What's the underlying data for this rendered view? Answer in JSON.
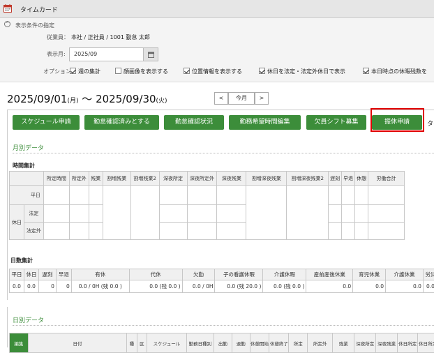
{
  "app": {
    "title": "タイムカード"
  },
  "conditions": {
    "toggle_label": "表示条件の指定",
    "employee_label": "従業員：",
    "employee_value": "本社 / 正社員 / 1001 勤怠 太郎",
    "month_label": "表示月:",
    "month_value": "2025/09",
    "options_label": "オプション:",
    "options": [
      {
        "label": "週の集計",
        "checked": true
      },
      {
        "label": "顔画像を表示する",
        "checked": false
      },
      {
        "label": "位置情報を表示する",
        "checked": true
      },
      {
        "label": "休日を法定・法定外休日で表示",
        "checked": true
      },
      {
        "label": "本日時点の休暇残数を",
        "checked": true
      }
    ]
  },
  "period": {
    "start": "2025/09/01",
    "start_dow": "(月)",
    "sep": "〜",
    "end": "2025/09/30",
    "end_dow": "(火)",
    "prev": "<",
    "today": "今月",
    "next": ">"
  },
  "actions": [
    {
      "label": "スケジュール申請"
    },
    {
      "label": "勤怠確認済みとする"
    },
    {
      "label": "勤怠確認状況"
    },
    {
      "label": "勤務希望時間編集"
    },
    {
      "label": "欠員シフト募集"
    },
    {
      "label": "振休申請"
    },
    {
      "label": "タイ"
    }
  ],
  "monthly": {
    "title": "月別データ",
    "time_title": "時間集計",
    "time_headers": [
      "所定時間",
      "所定外",
      "残業",
      "割増残業",
      "割増残業2",
      "深夜所定",
      "深夜所定外",
      "深夜残業",
      "割増深夜残業",
      "割増深夜残業2",
      "遅刻",
      "早退",
      "休憩",
      "労働合計"
    ],
    "row_weekday": "平日",
    "row_holiday": "休日",
    "row_legal": "法定",
    "row_nonlegal": "法定外",
    "days_title": "日数集計",
    "days_headers": [
      "平日",
      "休日",
      "遅刻",
      "早退",
      "有休",
      "代休",
      "欠勤",
      "子の看護休暇",
      "介護休暇",
      "産前産後休業",
      "育児休業",
      "介護休業",
      "労災"
    ],
    "days_values": [
      "0.0",
      "0.0",
      "0",
      "0",
      "0.0 / 0H (残 0.0 )",
      "0.0 (残 0.0 )",
      "0.0 / 0H",
      "0.0 (残 20.0 )",
      "0.0 (残 0.0 )",
      "0.0",
      "0.0",
      "0.0",
      "0.0"
    ]
  },
  "daily": {
    "title": "日別データ",
    "headers": [
      "編集",
      "日付",
      "種",
      "区",
      "スケジュール",
      "勤務日種別",
      "出勤",
      "退勤",
      "休憩開始",
      "休憩終了",
      "所定",
      "所定外",
      "残業",
      "深夜所定",
      "深夜残業",
      "休日所定",
      "休日所定"
    ]
  },
  "colors": {
    "accent": "#3c8d3a",
    "highlight": "#e00000"
  }
}
